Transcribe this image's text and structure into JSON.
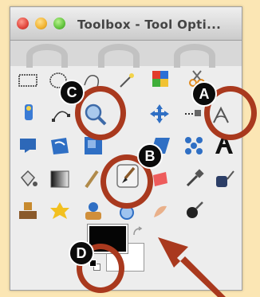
{
  "window": {
    "title": "Toolbox - Tool Opti...",
    "traffic_lights": [
      "close",
      "minimize",
      "zoom"
    ]
  },
  "tools": {
    "rows": [
      [
        "rect-select-icon",
        "ellipse-select-icon",
        "free-select-icon",
        "fuzzy-select-icon",
        "select-by-color-icon",
        "scissors-select-icon"
      ],
      [
        "foreground-select-icon",
        "paths-icon",
        "zoom-icon",
        "move-icon",
        "align-icon",
        "measure-icon"
      ],
      [
        "crop-icon",
        "rotate-icon",
        "scale-icon",
        "shear-icon",
        "cage-transform-icon",
        "text-icon"
      ],
      [
        "bucket-fill-icon",
        "blend-icon",
        "pencil-icon",
        "paintbrush-icon",
        "eraser-icon",
        "color-picker-icon"
      ],
      [
        "clone-icon",
        "heal-icon",
        "perspective-clone-icon",
        "blur-icon",
        "smudge-icon",
        "dodge-burn-icon"
      ]
    ]
  },
  "colors": {
    "foreground": "#000000",
    "background": "#ffffff",
    "annotation": "#a9391e",
    "page_background": "#fbe6b4"
  },
  "annotations": {
    "a": "A",
    "b": "B",
    "c": "C",
    "d": "D"
  }
}
